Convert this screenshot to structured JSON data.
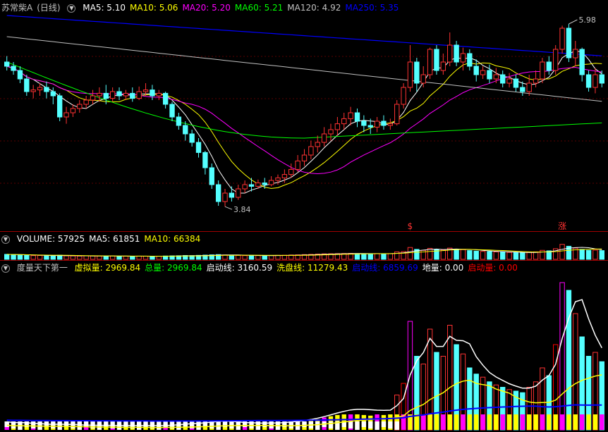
{
  "main_panel": {
    "stock_name": "苏常柴A",
    "period": "(日线)",
    "ma_labels": [
      {
        "text": "MA5: 5.10",
        "color": "#ffffff"
      },
      {
        "text": "MA10: 5.06",
        "color": "#ffff00"
      },
      {
        "text": "MA20: 5.20",
        "color": "#ff00ff"
      },
      {
        "text": "MA60: 5.21",
        "color": "#00ff00"
      },
      {
        "text": "MA120: 4.92",
        "color": "#c0c0c0"
      },
      {
        "text": "MA250: 5.35",
        "color": "#0000ff"
      }
    ],
    "high_marker": "5.98",
    "low_marker": "3.84",
    "signal_markers": [
      "$",
      "涨"
    ]
  },
  "volume_panel": {
    "labels": [
      {
        "text": "VOLUME: 57925",
        "color": "#ffffff"
      },
      {
        "text": "MA5: 61851",
        "color": "#ffffff"
      },
      {
        "text": "MA10: 66384",
        "color": "#ffff00"
      }
    ]
  },
  "indicator_panel": {
    "name": "度量天下第一",
    "labels": [
      {
        "text": "虚拟量: 2969.84",
        "color": "#ffff00"
      },
      {
        "text": "总量: 2969.84",
        "color": "#00ff00"
      },
      {
        "text": "启动线: 3160.59",
        "color": "#ffffff"
      },
      {
        "text": "洗盘线: 11279.43",
        "color": "#ffff00"
      },
      {
        "text": "启动线: 6859.69",
        "color": "#0000ff"
      },
      {
        "text": "地量: 0.00",
        "color": "#ffffff"
      },
      {
        "text": "启动量: 0.00",
        "color": "#ff0000"
      }
    ]
  },
  "chart_data": {
    "type": "candlestick",
    "title": "苏常柴A (日线)",
    "ylim": [
      3.6,
      6.1
    ],
    "candles": [
      [
        5.55,
        5.5,
        5.62,
        5.45
      ],
      [
        5.5,
        5.45,
        5.55,
        5.4
      ],
      [
        5.45,
        5.35,
        5.5,
        5.3
      ],
      [
        5.35,
        5.2,
        5.4,
        5.15
      ],
      [
        5.2,
        5.22,
        5.28,
        5.12
      ],
      [
        5.22,
        5.25,
        5.3,
        5.15
      ],
      [
        5.25,
        5.2,
        5.32,
        5.12
      ],
      [
        5.2,
        5.15,
        5.25,
        5.05
      ],
      [
        5.15,
        4.9,
        5.18,
        4.85
      ],
      [
        4.9,
        4.95,
        5.02,
        4.82
      ],
      [
        4.95,
        5.0,
        5.05,
        4.9
      ],
      [
        5.0,
        5.05,
        5.1,
        4.95
      ],
      [
        5.05,
        5.1,
        5.15,
        5.0
      ],
      [
        5.1,
        5.15,
        5.22,
        5.05
      ],
      [
        5.15,
        5.18,
        5.25,
        5.08
      ],
      [
        5.18,
        5.12,
        5.28,
        5.05
      ],
      [
        5.12,
        5.2,
        5.25,
        5.08
      ],
      [
        5.2,
        5.15,
        5.25,
        5.1
      ],
      [
        5.15,
        5.18,
        5.22,
        5.1
      ],
      [
        5.18,
        5.12,
        5.25,
        5.08
      ],
      [
        5.12,
        5.2,
        5.26,
        5.1
      ],
      [
        5.2,
        5.22,
        5.3,
        5.15
      ],
      [
        5.22,
        5.15,
        5.28,
        5.1
      ],
      [
        5.15,
        5.18,
        5.22,
        5.1
      ],
      [
        5.18,
        5.05,
        5.2,
        5.0
      ],
      [
        5.05,
        4.9,
        5.08,
        4.85
      ],
      [
        4.9,
        4.8,
        4.95,
        4.75
      ],
      [
        4.8,
        4.7,
        4.85,
        4.62
      ],
      [
        4.7,
        4.6,
        4.75,
        4.55
      ],
      [
        4.6,
        4.48,
        4.65,
        4.42
      ],
      [
        4.48,
        4.3,
        4.5,
        4.22
      ],
      [
        4.3,
        4.1,
        4.35,
        4.05
      ],
      [
        4.1,
        3.9,
        4.15,
        3.85
      ],
      [
        3.9,
        4.0,
        4.05,
        3.84
      ],
      [
        4.0,
        3.95,
        4.08,
        3.9
      ],
      [
        3.95,
        4.05,
        4.1,
        3.92
      ],
      [
        4.05,
        4.1,
        4.15,
        4.0
      ],
      [
        4.1,
        4.08,
        4.18,
        4.02
      ],
      [
        4.08,
        4.12,
        4.16,
        4.05
      ],
      [
        4.12,
        4.1,
        4.18,
        4.05
      ],
      [
        4.1,
        4.15,
        4.2,
        4.08
      ],
      [
        4.15,
        4.18,
        4.22,
        4.1
      ],
      [
        4.18,
        4.22,
        4.28,
        4.12
      ],
      [
        4.22,
        4.28,
        4.35,
        4.18
      ],
      [
        4.28,
        4.38,
        4.45,
        4.25
      ],
      [
        4.38,
        4.45,
        4.52,
        4.32
      ],
      [
        4.45,
        4.55,
        4.62,
        4.4
      ],
      [
        4.55,
        4.6,
        4.68,
        4.48
      ],
      [
        4.6,
        4.7,
        4.78,
        4.55
      ],
      [
        4.7,
        4.75,
        4.82,
        4.62
      ],
      [
        4.75,
        4.82,
        4.9,
        4.68
      ],
      [
        4.82,
        4.88,
        4.95,
        4.75
      ],
      [
        4.88,
        4.95,
        5.02,
        4.8
      ],
      [
        4.95,
        4.85,
        5.0,
        4.78
      ],
      [
        4.85,
        4.8,
        4.92,
        4.72
      ],
      [
        4.8,
        4.78,
        4.88,
        4.7
      ],
      [
        4.78,
        4.85,
        4.9,
        4.72
      ],
      [
        4.85,
        4.8,
        4.92,
        4.75
      ],
      [
        4.8,
        4.82,
        4.88,
        4.75
      ],
      [
        4.82,
        5.05,
        5.1,
        4.8
      ],
      [
        5.05,
        5.25,
        5.3,
        5.0
      ],
      [
        5.25,
        5.55,
        5.75,
        5.2
      ],
      [
        5.55,
        5.3,
        5.6,
        5.2
      ],
      [
        5.3,
        5.4,
        5.5,
        5.25
      ],
      [
        5.4,
        5.7,
        5.72,
        5.35
      ],
      [
        5.7,
        5.45,
        5.75,
        5.4
      ],
      [
        5.45,
        5.55,
        5.65,
        5.4
      ],
      [
        5.55,
        5.75,
        5.9,
        5.5
      ],
      [
        5.75,
        5.55,
        5.8,
        5.5
      ],
      [
        5.55,
        5.65,
        5.72,
        5.45
      ],
      [
        5.65,
        5.5,
        5.7,
        5.45
      ],
      [
        5.5,
        5.4,
        5.58,
        5.32
      ],
      [
        5.4,
        5.45,
        5.5,
        5.35
      ],
      [
        5.45,
        5.35,
        5.52,
        5.3
      ],
      [
        5.35,
        5.4,
        5.48,
        5.3
      ],
      [
        5.4,
        5.3,
        5.45,
        5.25
      ],
      [
        5.3,
        5.35,
        5.42,
        5.25
      ],
      [
        5.35,
        5.25,
        5.4,
        5.2
      ],
      [
        5.25,
        5.2,
        5.32,
        5.15
      ],
      [
        5.2,
        5.3,
        5.4,
        5.15
      ],
      [
        5.3,
        5.35,
        5.45,
        5.25
      ],
      [
        5.35,
        5.55,
        5.6,
        5.3
      ],
      [
        5.55,
        5.45,
        5.62,
        5.4
      ],
      [
        5.45,
        5.7,
        5.75,
        5.4
      ],
      [
        5.7,
        5.95,
        5.98,
        5.65
      ],
      [
        5.95,
        5.6,
        6.0,
        5.55
      ],
      [
        5.6,
        5.7,
        5.8,
        5.5
      ],
      [
        5.7,
        5.4,
        5.72,
        5.32
      ],
      [
        5.4,
        5.25,
        5.45,
        5.2
      ],
      [
        5.25,
        5.4,
        5.48,
        5.18
      ],
      [
        5.4,
        5.3,
        5.45,
        5.25
      ]
    ],
    "volume": [
      40,
      38,
      35,
      34,
      30,
      31,
      29,
      30,
      33,
      28,
      27,
      26,
      28,
      27,
      26,
      25,
      27,
      26,
      25,
      24,
      26,
      25,
      24,
      25,
      27,
      28,
      29,
      31,
      30,
      32,
      34,
      36,
      38,
      35,
      33,
      32,
      30,
      31,
      30,
      29,
      31,
      32,
      33,
      35,
      36,
      38,
      40,
      42,
      44,
      45,
      46,
      47,
      48,
      46,
      45,
      44,
      46,
      45,
      46,
      60,
      62,
      95,
      80,
      72,
      88,
      78,
      75,
      90,
      82,
      78,
      70,
      66,
      64,
      62,
      60,
      58,
      56,
      54,
      52,
      56,
      60,
      72,
      68,
      85,
      120,
      105,
      90,
      80,
      72,
      74,
      70
    ],
    "indicator": [
      10,
      8,
      9,
      8,
      7,
      7,
      6,
      7,
      8,
      6,
      6,
      5,
      6,
      6,
      5,
      5,
      6,
      5,
      5,
      5,
      6,
      5,
      5,
      5,
      6,
      7,
      7,
      8,
      8,
      9,
      10,
      11,
      12,
      10,
      9,
      9,
      8,
      9,
      8,
      8,
      9,
      9,
      10,
      11,
      12,
      13,
      15,
      17,
      20,
      22,
      24,
      25,
      27,
      25,
      24,
      23,
      25,
      24,
      25,
      45,
      60,
      140,
      95,
      85,
      130,
      100,
      95,
      135,
      110,
      98,
      80,
      72,
      68,
      62,
      58,
      55,
      52,
      50,
      48,
      55,
      62,
      80,
      70,
      110,
      190,
      180,
      150,
      120,
      95,
      100,
      88
    ]
  }
}
